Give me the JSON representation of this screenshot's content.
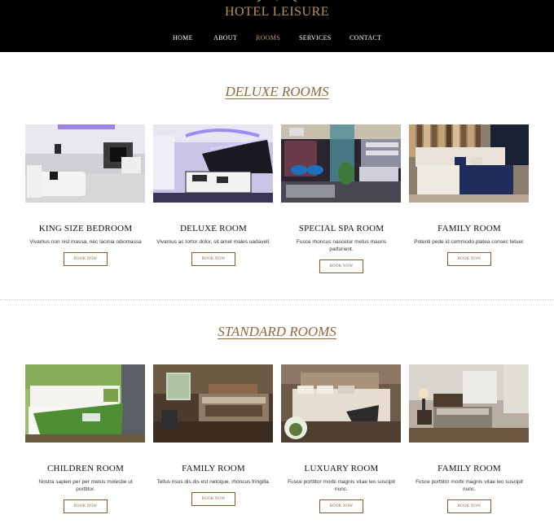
{
  "header": {
    "logo_text": "HOTEL LEISURE",
    "nav": [
      {
        "label": "HOME"
      },
      {
        "label": "ABOUT"
      },
      {
        "label": "ROOMS",
        "active": true
      },
      {
        "label": "SERVICES"
      },
      {
        "label": "CONTACT"
      }
    ]
  },
  "colors": {
    "accent": "#8b6a3e",
    "nav_active": "#c69e63",
    "header_bg": "#000000"
  },
  "sections": [
    {
      "title": "DELUXE ROOMS",
      "rooms": [
        {
          "name": "KING SIZE BEDROOM",
          "desc": "Vivamus non nisl massa, nec lacinia odiomassa",
          "button": "BOOK NOW"
        },
        {
          "name": "DELUXE ROOM",
          "desc": "Vivamus ac tortor dolor, sit amet males uadavell.",
          "button": "BOOK NOW"
        },
        {
          "name": "SPECIAL SPA ROOM",
          "desc": "Fusce rhoncus nascetur metus mauris parturient.",
          "button": "BOOK NOW"
        },
        {
          "name": "FAMILY ROOM",
          "desc": "Potenti pede id commodo platea consec tetuer.",
          "button": "BOOK NOW"
        }
      ]
    },
    {
      "title": "STANDARD ROOMS",
      "rooms": [
        {
          "name": "CHILDREN ROOM",
          "desc": "Nostra sapien per per metus molestie ut porttitor.",
          "button": "BOOK NOW"
        },
        {
          "name": "FAMILY ROOM",
          "desc": "Tellus risus dis dis est netoque, rhoncus fringilla.",
          "button": "BOOK NOW"
        },
        {
          "name": "LUXUARY ROOM",
          "desc": "Fusce porttitor morbi magnis vitae leo suscipit nunc.",
          "button": "BOOK NOW"
        },
        {
          "name": "FAMILY ROOM",
          "desc": "Fusce porttitor morbi magnis vitae leo suscipit nunc.",
          "button": "BOOK NOW"
        }
      ]
    }
  ]
}
